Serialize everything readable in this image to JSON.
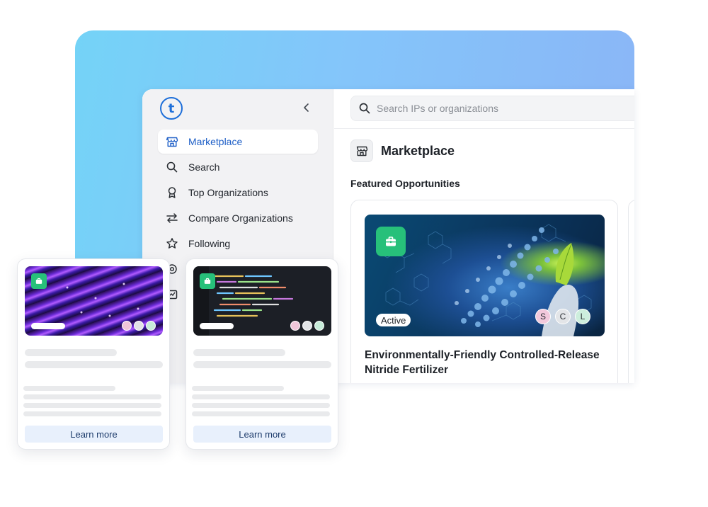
{
  "sidebar": {
    "logo_letter": "t",
    "items": [
      {
        "label": "Marketplace",
        "icon": "store-icon",
        "active": true
      },
      {
        "label": "Search",
        "icon": "search-icon"
      },
      {
        "label": "Top Organizations",
        "icon": "award-icon"
      },
      {
        "label": "Compare Organizations",
        "icon": "compare-arrows-icon"
      },
      {
        "label": "Following",
        "icon": "star-icon"
      }
    ]
  },
  "search": {
    "placeholder": "Search IPs or organizations"
  },
  "page": {
    "title": "Marketplace",
    "section_title": "Featured Opportunities"
  },
  "featured_card": {
    "status": "Active",
    "title": "Environmentally-Friendly Controlled-Release Nitride Fertilizer",
    "avatars": [
      {
        "letter": "S",
        "color": "#f2c9dc"
      },
      {
        "letter": "C",
        "color": "#e3e5e8"
      },
      {
        "letter": "L",
        "color": "#cdeedd"
      }
    ],
    "badge_color": "#27c07a"
  },
  "mini_cards": [
    {
      "button": "Learn more",
      "dots": [
        "#f0c6d9",
        "#e1e3e6",
        "#c7ecd9"
      ]
    },
    {
      "button": "Learn more",
      "dots": [
        "#f0c6d9",
        "#e1e3e6",
        "#c7ecd9"
      ]
    }
  ],
  "colors": {
    "accent": "#1e6fd9",
    "badge": "#27c07a",
    "gradient_start": "#74d3f7",
    "gradient_end": "#8bb4f6"
  }
}
